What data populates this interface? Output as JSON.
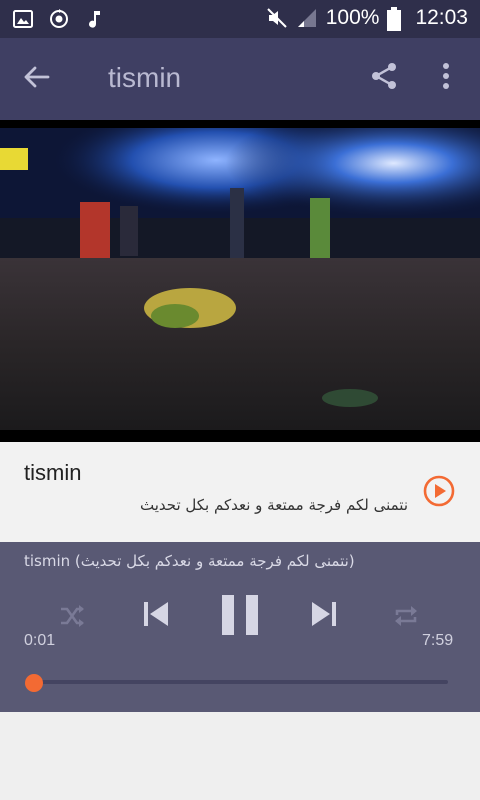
{
  "status_bar": {
    "battery_text": "100%",
    "time": "12:03",
    "icons": [
      "image-icon",
      "sync-icon",
      "music-note-icon",
      "mute-icon",
      "signal-icon",
      "battery-icon"
    ]
  },
  "toolbar": {
    "title": "tismin",
    "icons": [
      "back-arrow-icon",
      "share-icon",
      "more-vert-icon"
    ]
  },
  "track": {
    "title": "tismin",
    "subtitle": "نتمنى لكم فرجة ممتعة و نعدكم بكل تحديث",
    "accent": "#f36a33"
  },
  "player": {
    "now_playing": "tismin (نتمنى لكم فرجة ممتعة و نعدكم بكل تحديث)",
    "elapsed": "0:01",
    "duration": "7:59",
    "progress": 0.002,
    "controls": [
      "shuffle-icon",
      "previous-icon",
      "pause-icon",
      "next-icon",
      "repeat-icon"
    ]
  },
  "colors": {
    "status_bar": "#2f2f4b",
    "app_bar": "#3f3f63",
    "player": "#595974",
    "accent": "#f36a33"
  }
}
